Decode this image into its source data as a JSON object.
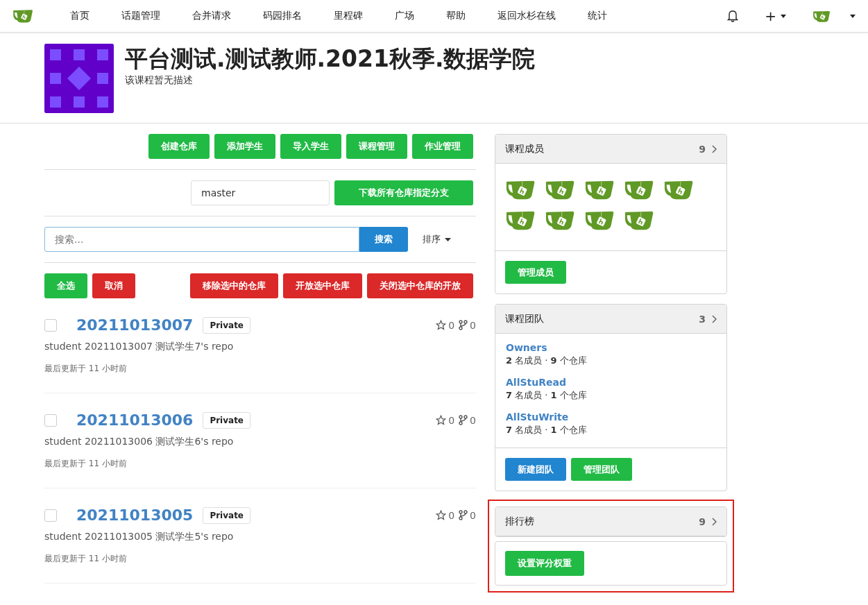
{
  "nav": {
    "items": [
      "首页",
      "话题管理",
      "合并请求",
      "码园排名",
      "里程碑",
      "广场",
      "帮助",
      "返回水杉在线",
      "统计"
    ],
    "plus": "+"
  },
  "header": {
    "title": "平台测试.测试教师.2021秋季.数据学院",
    "description": "该课程暂无描述"
  },
  "actions": [
    "创建仓库",
    "添加学生",
    "导入学生",
    "课程管理",
    "作业管理"
  ],
  "branch": {
    "value": "master",
    "button": "下载所有仓库指定分支"
  },
  "search": {
    "placeholder": "搜索...",
    "button": "搜索",
    "sort": "排序"
  },
  "bulk": [
    {
      "label": "全选",
      "kind": "green"
    },
    {
      "label": "取消",
      "kind": "red"
    },
    {
      "label": "移除选中的仓库",
      "kind": "red"
    },
    {
      "label": "开放选中仓库",
      "kind": "red"
    },
    {
      "label": "关闭选中仓库的开放",
      "kind": "red"
    }
  ],
  "repos": [
    {
      "name": "20211013007",
      "badge": "Private",
      "checked": false,
      "stars": "0",
      "forks": "0",
      "description": "student 20211013007 测试学生7's repo",
      "updated": "最后更新于 11 小时前"
    },
    {
      "name": "20211013006",
      "badge": "Private",
      "checked": false,
      "stars": "0",
      "forks": "0",
      "description": "student 20211013006 测试学生6's repo",
      "updated": "最后更新于 11 小时前"
    },
    {
      "name": "20211013005",
      "badge": "Private",
      "checked": false,
      "stars": "0",
      "forks": "0",
      "description": "student 20211013005 测试学生5's repo",
      "updated": "最后更新于 11 小时前"
    }
  ],
  "members_panel": {
    "title": "课程成员",
    "count": "9",
    "avatars": [
      {
        "kind": "teacup"
      },
      {
        "kind": "teacup"
      },
      {
        "kind": "teacup"
      },
      {
        "kind": "teacup"
      },
      {
        "kind": "teacup"
      },
      {
        "kind": "teacup"
      },
      {
        "kind": "teacup"
      },
      {
        "kind": "teacup"
      },
      {
        "kind": "teacup"
      }
    ],
    "buttons": [
      {
        "label": "管理成员",
        "kind": "green"
      }
    ]
  },
  "teams_panel": {
    "title": "课程团队",
    "count": "3",
    "teams": [
      {
        "name": "Owners",
        "info": "**2** 名成员 · **9** 个仓库"
      },
      {
        "name": "AllStuRead",
        "info": "**7** 名成员 · **1** 个仓库"
      },
      {
        "name": "AllStuWrite",
        "info": "**7** 名成员 · **1** 个仓库"
      }
    ],
    "buttons": [
      {
        "label": "新建团队",
        "kind": "blue"
      },
      {
        "label": "管理团队",
        "kind": "green"
      }
    ]
  },
  "ranking_panel": {
    "title": "排行榜",
    "count": "9",
    "highlighted": true,
    "buttons": [
      {
        "label": "设置评分权重",
        "kind": "green"
      }
    ]
  }
}
